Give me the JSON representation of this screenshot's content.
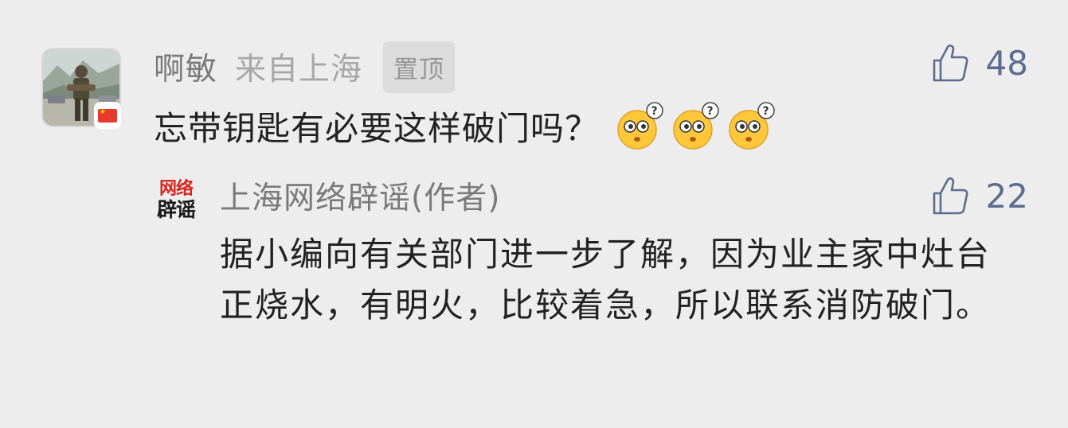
{
  "comment": {
    "username": "啊敏",
    "location": "来自上海",
    "pinned_label": "置顶",
    "likes": "48",
    "text": "忘带钥匙有必要这样破门吗？",
    "emojis": [
      "confused-face-emoji",
      "confused-face-emoji",
      "confused-face-emoji"
    ]
  },
  "reply": {
    "avatar_line1": "网络",
    "avatar_line2": "辟谣",
    "author": "上海网络辟谣(作者)",
    "likes": "22",
    "text": "据小编向有关部门进一步了解，因为业主家中灶台正烧水，有明火，比较着急，所以联系消防破门。"
  },
  "colors": {
    "background": "#ededed",
    "like_accent": "#5b6c8e",
    "emoji_yellow": "#ffc83a",
    "logo_red": "#d8261f"
  }
}
